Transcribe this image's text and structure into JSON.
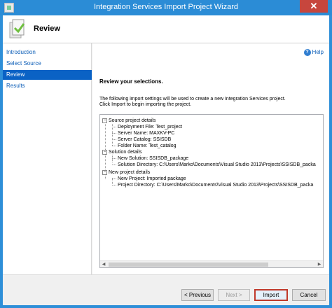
{
  "window": {
    "title": "Integration Services Import Project Wizard",
    "close_glyph": "✕"
  },
  "header": {
    "title": "Review",
    "icon": "wizard-page-icon"
  },
  "nav": {
    "items": [
      {
        "label": "Introduction",
        "active": false
      },
      {
        "label": "Select Source",
        "active": false
      },
      {
        "label": "Review",
        "active": true
      },
      {
        "label": "Results",
        "active": false
      }
    ]
  },
  "content": {
    "help_label": "Help",
    "section_title": "Review your selections.",
    "desc_line1": "The following import settings will be used to create a new Integration Services project.",
    "desc_line2": "Click Import to begin importing the project.",
    "tree": {
      "source_group": "Source project details",
      "deployment_file": "Deployment File: Test_project",
      "server_name": "Server Name: MAXKV-PC",
      "server_catalog": "Server Catalog: SSISDB",
      "folder_name": "Folder Name: Test_catalog",
      "solution_group": "Solution details",
      "new_solution": "New Solution: SSISDB_package",
      "solution_directory": "Solution Directory: C:\\Users\\Marko\\Documents\\Visual Studio 2013\\Projects\\SSISDB_packa",
      "project_group": "New project details",
      "new_project": "New Project: Imported package",
      "project_directory": "Project Directory: C:\\Users\\Marko\\Documents\\Visual Studio 2013\\Projects\\SSISDB_packa",
      "collapse_glyph": "−"
    }
  },
  "footer": {
    "previous_label": "< Previous",
    "next_label": "Next >",
    "import_label": "Import",
    "cancel_label": "Cancel"
  },
  "colors": {
    "titlebar": "#2b8cd6",
    "nav_active": "#0a62c5",
    "link": "#0b5db7",
    "import_border": "#c0392b"
  }
}
